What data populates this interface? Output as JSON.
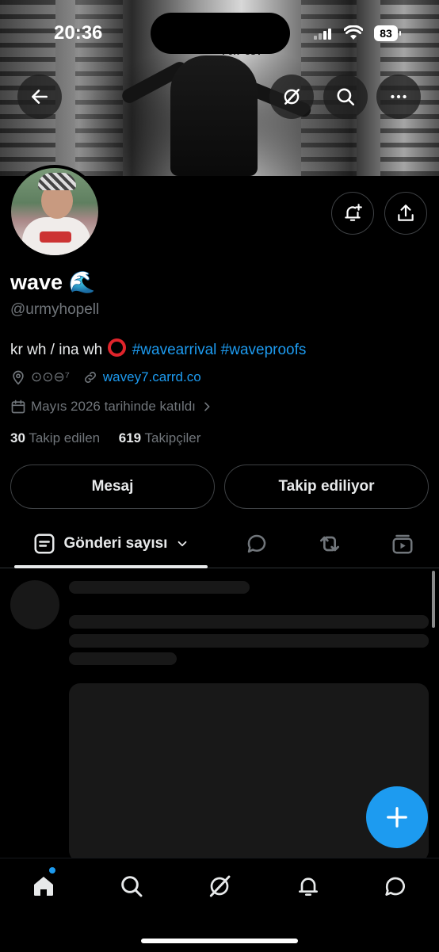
{
  "status_bar": {
    "time": "20:36",
    "battery": "83"
  },
  "profile": {
    "name": "wave 🌊",
    "handle": "@urmyhopell",
    "bio_text": "kr wh / ina wh",
    "bio_tags": [
      "#wavearrival",
      "#waveproofs"
    ],
    "location": "⊙⊙⊖⁷",
    "website": "wavey7.carrd.co",
    "joined": "Mayıs 2026 tarihinde katıldı",
    "following_count": "30",
    "following_label": "Takip edilen",
    "followers_count": "619",
    "followers_label": "Takipçiler"
  },
  "banner_sign": "FOR US.",
  "actions": {
    "message": "Mesaj",
    "following": "Takip ediliyor"
  },
  "tabs": {
    "active_label": "Gönderi sayısı"
  },
  "colors": {
    "accent": "#1d9bf0",
    "background": "#000000",
    "muted": "#71767b"
  },
  "icons": {
    "top_bar": [
      "back-arrow-icon",
      "grok-icon",
      "search-icon",
      "more-icon"
    ],
    "profile": [
      "notification-plus-icon",
      "share-icon"
    ],
    "tabs": [
      "posts-icon",
      "replies-icon",
      "reposts-icon",
      "media-icon"
    ],
    "nav": [
      "home-icon",
      "search-icon",
      "grok-icon",
      "notifications-icon",
      "messages-icon"
    ]
  }
}
